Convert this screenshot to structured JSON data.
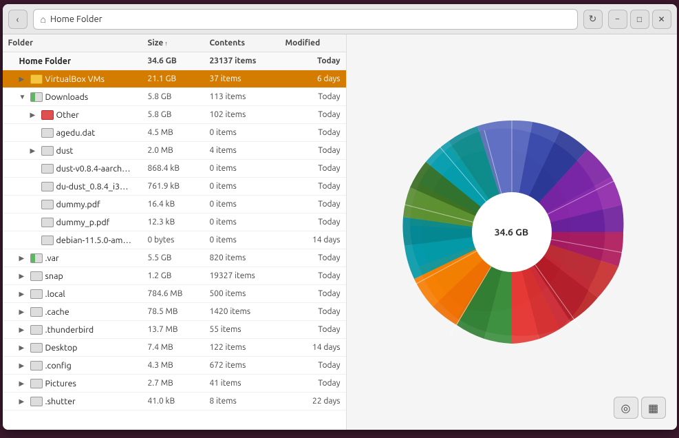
{
  "window": {
    "title": "Home Folder",
    "back_button": "‹",
    "home_icon": "⌂",
    "refresh_icon": "↻",
    "minimize_icon": "−",
    "maximize_icon": "□",
    "close_icon": "✕"
  },
  "columns": {
    "folder": "Folder",
    "size": "Size",
    "size_arrow": "↑",
    "contents": "Contents",
    "modified": "Modified"
  },
  "rows": [
    {
      "id": "home",
      "name": "Home Folder",
      "size": "34.6 GB",
      "contents": "23137 items",
      "modified": "Today",
      "level": 0,
      "expanded": true,
      "arrow": "",
      "icon": "none",
      "root": true
    },
    {
      "id": "virtualbox",
      "name": "VirtualBox VMs",
      "size": "21.1 GB",
      "contents": "37 items",
      "modified": "6 days",
      "level": 1,
      "expanded": false,
      "arrow": "▶",
      "icon": "yellow",
      "selected": true
    },
    {
      "id": "downloads",
      "name": "Downloads",
      "size": "5.8 GB",
      "contents": "113 items",
      "modified": "Today",
      "level": 1,
      "expanded": true,
      "arrow": "▼",
      "icon": "green-bar"
    },
    {
      "id": "other",
      "name": "Other",
      "size": "5.8 GB",
      "contents": "102 items",
      "modified": "Today",
      "level": 2,
      "expanded": false,
      "arrow": "▶",
      "icon": "red"
    },
    {
      "id": "agedu",
      "name": "agedu.dat",
      "size": "4.5 MB",
      "contents": "0 items",
      "modified": "Today",
      "level": 2,
      "expanded": false,
      "arrow": "",
      "icon": "file"
    },
    {
      "id": "dust",
      "name": "dust",
      "size": "2.0 MB",
      "contents": "4 items",
      "modified": "Today",
      "level": 2,
      "expanded": false,
      "arrow": "▶",
      "icon": "folder"
    },
    {
      "id": "dust-v084",
      "name": "dust-v0.8.4-aarch…",
      "size": "868.4 kB",
      "contents": "0 items",
      "modified": "Today",
      "level": 2,
      "expanded": false,
      "arrow": "",
      "icon": "file"
    },
    {
      "id": "du-dust",
      "name": "du-dust_0.8.4_i3…",
      "size": "761.9 kB",
      "contents": "0 items",
      "modified": "Today",
      "level": 2,
      "expanded": false,
      "arrow": "",
      "icon": "file"
    },
    {
      "id": "dummy-pdf",
      "name": "dummy.pdf",
      "size": "16.4 kB",
      "contents": "0 items",
      "modified": "Today",
      "level": 2,
      "expanded": false,
      "arrow": "",
      "icon": "file"
    },
    {
      "id": "dummy-p-pdf",
      "name": "dummy_p.pdf",
      "size": "12.3 kB",
      "contents": "0 items",
      "modified": "Today",
      "level": 2,
      "expanded": false,
      "arrow": "",
      "icon": "file"
    },
    {
      "id": "debian",
      "name": "debian-11.5.0-am…",
      "size": "0 bytes",
      "contents": "0 items",
      "modified": "14 days",
      "level": 2,
      "expanded": false,
      "arrow": "",
      "icon": "file"
    },
    {
      "id": "var",
      "name": ".var",
      "size": "5.5 GB",
      "contents": "820 items",
      "modified": "Today",
      "level": 1,
      "expanded": false,
      "arrow": "▶",
      "icon": "green-bar"
    },
    {
      "id": "snap",
      "name": "snap",
      "size": "1.2 GB",
      "contents": "19327 items",
      "modified": "Today",
      "level": 1,
      "expanded": false,
      "arrow": "▶",
      "icon": "folder"
    },
    {
      "id": "local",
      "name": ".local",
      "size": "784.6 MB",
      "contents": "500 items",
      "modified": "Today",
      "level": 1,
      "expanded": false,
      "arrow": "▶",
      "icon": "folder"
    },
    {
      "id": "cache",
      "name": ".cache",
      "size": "78.5 MB",
      "contents": "1420 items",
      "modified": "Today",
      "level": 1,
      "expanded": false,
      "arrow": "▶",
      "icon": "folder"
    },
    {
      "id": "thunderbird",
      "name": ".thunderbird",
      "size": "13.7 MB",
      "contents": "55 items",
      "modified": "Today",
      "level": 1,
      "expanded": false,
      "arrow": "▶",
      "icon": "folder"
    },
    {
      "id": "desktop",
      "name": "Desktop",
      "size": "7.4 MB",
      "contents": "122 items",
      "modified": "14 days",
      "level": 1,
      "expanded": false,
      "arrow": "▶",
      "icon": "folder"
    },
    {
      "id": "config",
      "name": ".config",
      "size": "4.3 MB",
      "contents": "672 items",
      "modified": "Today",
      "level": 1,
      "expanded": false,
      "arrow": "▶",
      "icon": "folder"
    },
    {
      "id": "pictures",
      "name": "Pictures",
      "size": "2.7 MB",
      "contents": "41 items",
      "modified": "Today",
      "level": 1,
      "expanded": false,
      "arrow": "▶",
      "icon": "folder"
    },
    {
      "id": "shutter",
      "name": ".shutter",
      "size": "41.0 kB",
      "contents": "8 items",
      "modified": "22 days",
      "level": 1,
      "expanded": false,
      "arrow": "▶",
      "icon": "folder"
    }
  ],
  "chart": {
    "center_label": "34.6 GB"
  },
  "toolbar": {
    "view_icon": "◎",
    "list_icon": "▦"
  }
}
